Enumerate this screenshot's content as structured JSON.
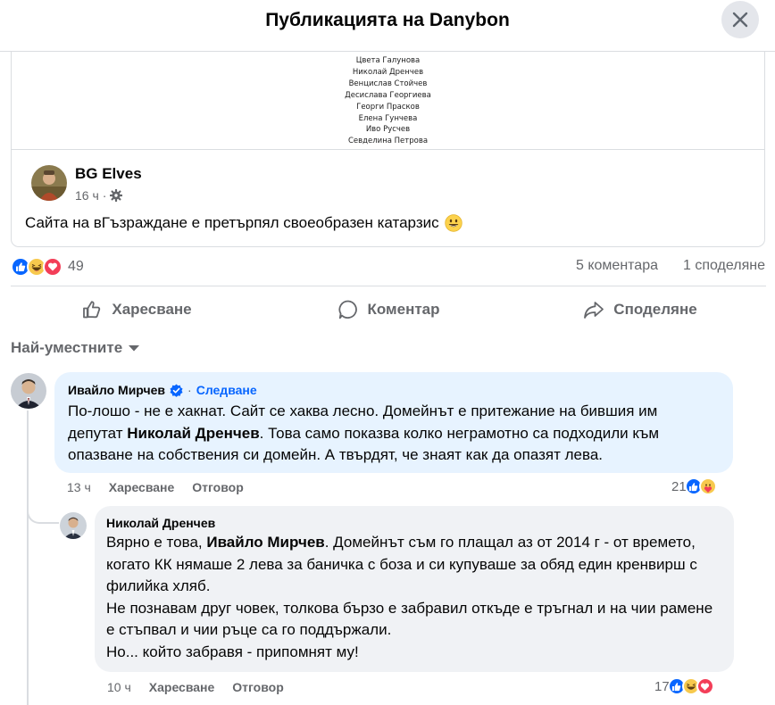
{
  "header": {
    "title": "Публикацията на Danybon"
  },
  "shared_image": {
    "names": [
      "Цвета Галунова",
      "Николай Дренчев",
      "Венцислав Стойчев",
      "Десислава Георгиева",
      "Георги Прасков",
      "Елена Гунчева",
      "Иво Русчев",
      "Севделина Петрова"
    ]
  },
  "shared_post": {
    "author": "BG Elves",
    "time": "16 ч",
    "text": "Сайта на вГъзраждане е претърпял своеобразен катарзис"
  },
  "stats": {
    "reactions": "49",
    "comments": "5 коментара",
    "shares": "1 споделяне"
  },
  "actions": {
    "like": "Харесване",
    "comment": "Коментар",
    "share": "Споделяне"
  },
  "sort": {
    "label": "Най-уместните"
  },
  "comments": [
    {
      "author": "Ивайло Мирчев",
      "follow": "Следване",
      "text_1": "По-лошо - не е хакнат. Сайт се хаква лесно. Домейнът е притежание на бившия им депутат ",
      "mention": "Николай Дренчев",
      "text_2": ". Това само показва колко неграмотно са подходили към опазване на собствения си домейн. А твърдят, че знаят как да опазят лева.",
      "time": "13 ч",
      "like": "Харесване",
      "reply": "Отговор",
      "reaction_count": "21"
    },
    {
      "author": "Николай Дренчев",
      "text_1": "Вярно е това, ",
      "mention": "Ивайло Мирчев",
      "text_2": ". Домейнът съм го плащал аз от 2014 г - от времето, когато КК нямаше 2 лева за баничка с боза и си купуваше за обяд един кренвирш с филийка хляб.",
      "line_2": "Не познавам друг човек, толкова бързо е забравил откъде е тръгнал и на чии рамене е стъпвал и чии ръце са го поддържали.",
      "line_3": "Но... който забравя - припомнят му!",
      "time": "10 ч",
      "like": "Харесване",
      "reply": "Отговор",
      "reaction_count": "17"
    }
  ],
  "colors": {
    "accent": "#0866ff",
    "secondary_text": "#65676b",
    "bubble": "#f0f2f5",
    "bubble_hover": "#e7f3ff"
  }
}
